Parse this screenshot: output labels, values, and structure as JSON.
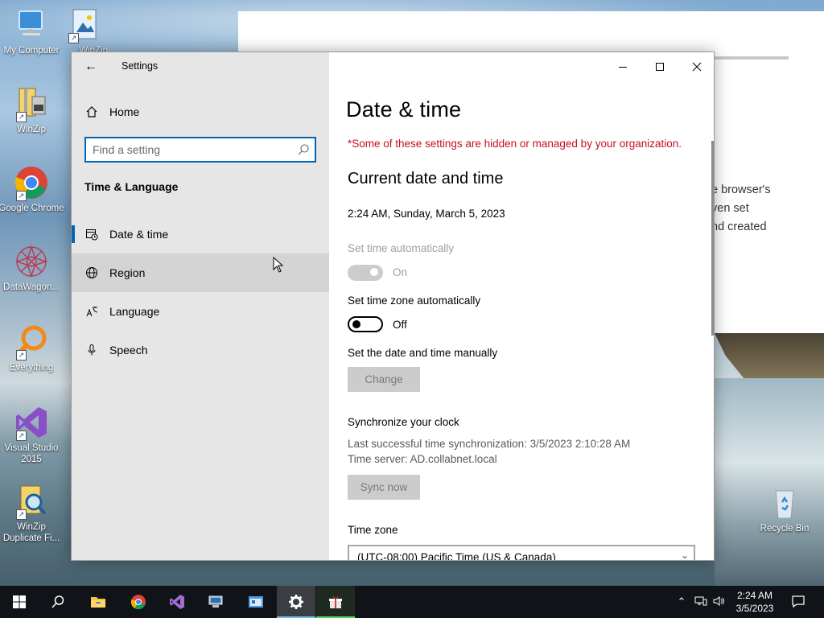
{
  "desktop": {
    "icons": [
      {
        "label": "My Computer",
        "icon": "computer-icon"
      },
      {
        "label": "WinZip",
        "icon": "winzip-icon"
      },
      {
        "label": "Google Chrome",
        "icon": "chrome-icon"
      },
      {
        "label": "DataWagon...",
        "icon": "datawagon-icon"
      },
      {
        "label": "Everything",
        "icon": "everything-search-icon"
      },
      {
        "label": "Visual Studio 2015",
        "icon": "visual-studio-icon"
      },
      {
        "label": "WinZip Duplicate Fi...",
        "icon": "winzip-duplicate-icon"
      },
      {
        "label": "Recycle Bin",
        "icon": "recycle-bin-icon"
      }
    ],
    "second_icon_partial_label": "WinZip"
  },
  "background_window": {
    "lines": [
      "e browser's",
      "ven set",
      "nd created"
    ]
  },
  "settings": {
    "app_title": "Settings",
    "home_label": "Home",
    "search_placeholder": "Find a setting",
    "section": "Time & Language",
    "nav_items": [
      {
        "label": "Date & time",
        "icon": "clock-calendar-icon",
        "active": true
      },
      {
        "label": "Region",
        "icon": "globe-icon",
        "active": false
      },
      {
        "label": "Language",
        "icon": "language-icon",
        "active": false
      },
      {
        "label": "Speech",
        "icon": "microphone-icon",
        "active": false
      }
    ],
    "page": {
      "title": "Date & time",
      "warning": "*Some of these settings are hidden or managed by your organization.",
      "current_heading": "Current date and time",
      "current_value": "2:24 AM, Sunday, March 5, 2023",
      "set_time_auto_label": "Set time automatically",
      "set_time_auto_state": "On",
      "set_tz_auto_label": "Set time zone automatically",
      "set_tz_auto_state": "Off",
      "manual_label": "Set the date and time manually",
      "change_button": "Change",
      "sync_heading": "Synchronize your clock",
      "sync_last": "Last successful time synchronization: 3/5/2023 2:10:28 AM",
      "sync_server": "Time server: AD.collabnet.local",
      "sync_button": "Sync now",
      "timezone_label": "Time zone",
      "timezone_value": "(UTC-08:00) Pacific Time (US & Canada)"
    }
  },
  "taskbar": {
    "clock_time": "2:24 AM",
    "clock_date": "3/5/2023"
  }
}
